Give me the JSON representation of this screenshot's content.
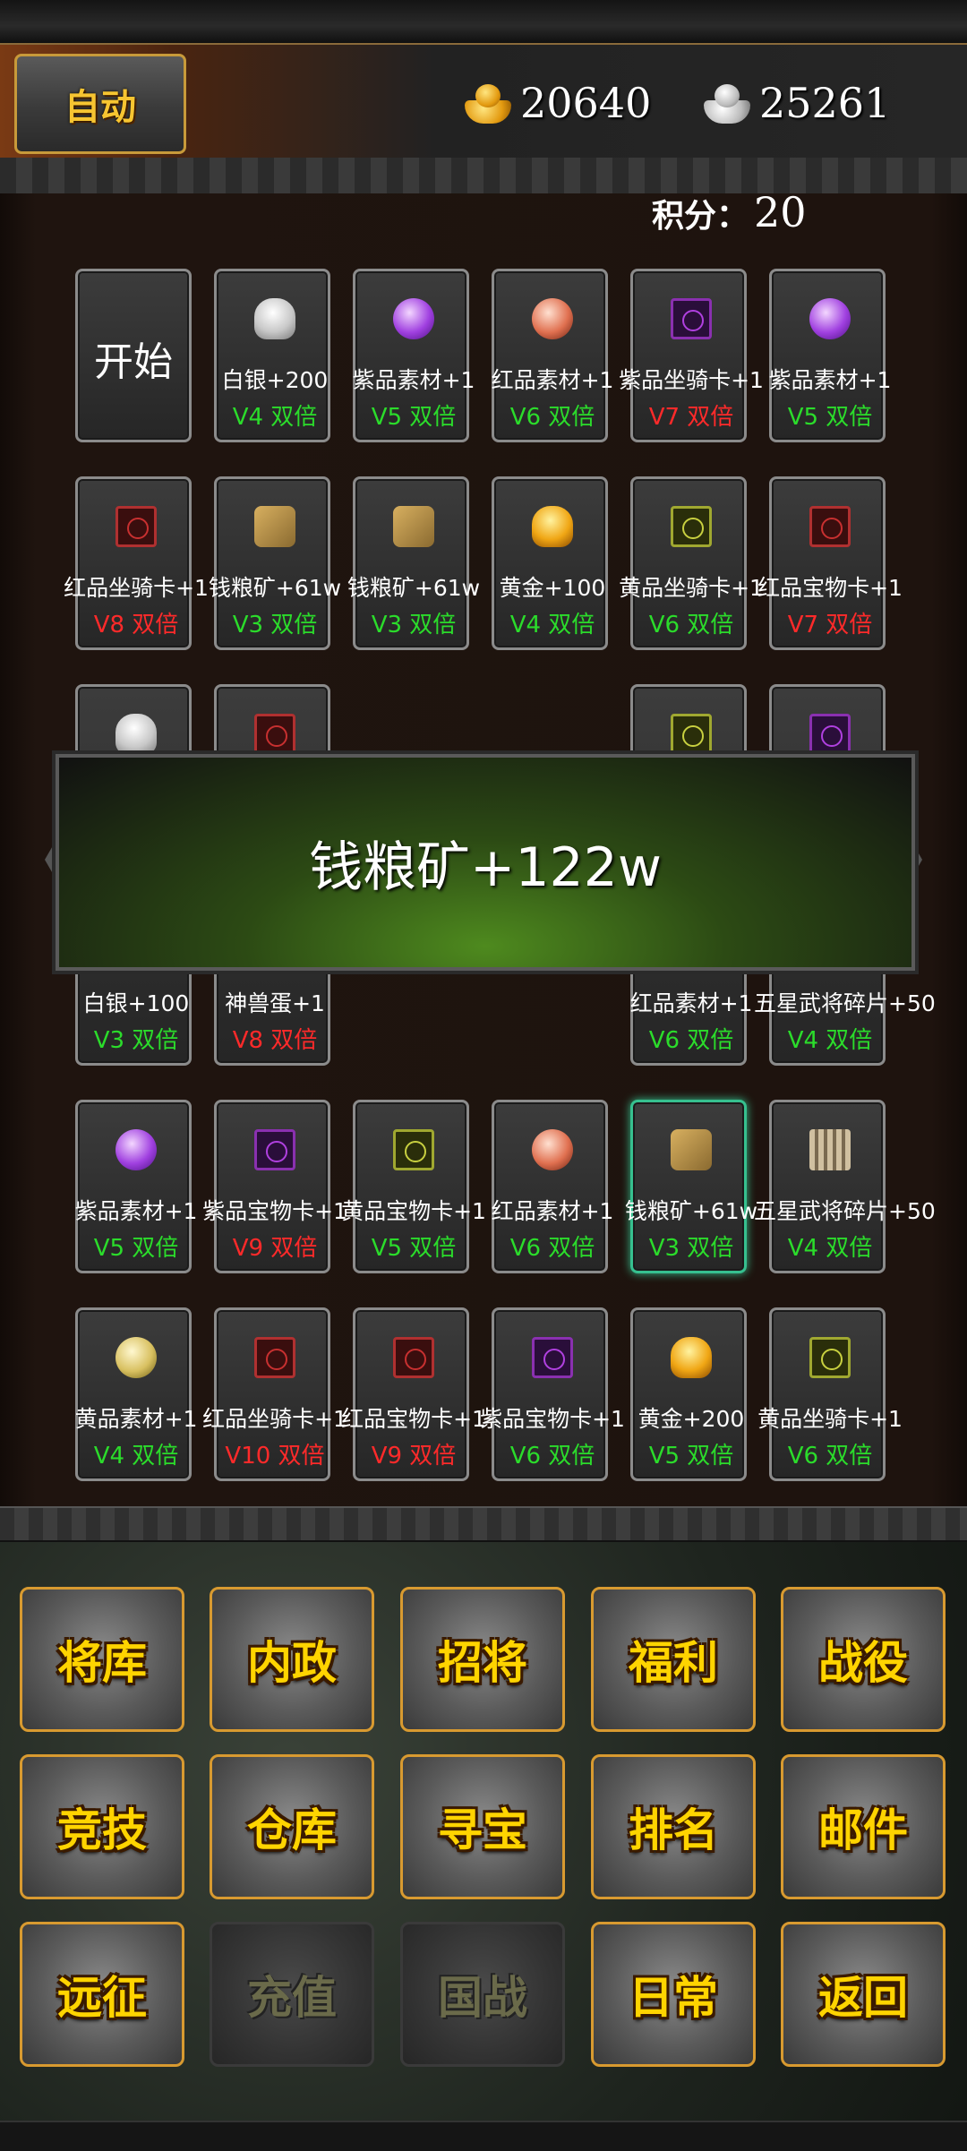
{
  "header": {
    "auto_label": "自动",
    "gold_amount": "20640",
    "silver_amount": "25261"
  },
  "score": {
    "label": "积分：",
    "value": "20"
  },
  "start_label": "开始",
  "cells": [
    {
      "name": "白银+200",
      "vip": "V4 双倍",
      "color": "green",
      "icon": "silver-ingot-icon"
    },
    {
      "name": "紫品素材+1",
      "vip": "V5 双倍",
      "color": "green",
      "icon": "purple-gem-icon"
    },
    {
      "name": "红品素材+1",
      "vip": "V6 双倍",
      "color": "green",
      "icon": "red-gem-icon"
    },
    {
      "name": "紫品坐骑卡+1",
      "vip": "V7 双倍",
      "color": "red",
      "icon": "purple-mount-card-icon"
    },
    {
      "name": "紫品素材+1",
      "vip": "V5 双倍",
      "color": "green",
      "icon": "purple-gem-icon"
    },
    {
      "name": "红品坐骑卡+1",
      "vip": "V8 双倍",
      "color": "red",
      "icon": "red-mount-card-icon"
    },
    {
      "name": "钱粮矿+61w",
      "vip": "V3 双倍",
      "color": "green",
      "icon": "grain-icon"
    },
    {
      "name": "钱粮矿+61w",
      "vip": "V3 双倍",
      "color": "green",
      "icon": "grain-icon"
    },
    {
      "name": "黄金+100",
      "vip": "V4 双倍",
      "color": "green",
      "icon": "gold-ingot-icon"
    },
    {
      "name": "黄品坐骑卡+1",
      "vip": "V6 双倍",
      "color": "green",
      "icon": "yellow-mount-card-icon"
    },
    {
      "name": "红品宝物卡+1",
      "vip": "V7 双倍",
      "color": "red",
      "icon": "red-treasure-card-icon"
    },
    {
      "name": "白银+100",
      "vip": "V3 双倍",
      "color": "green",
      "icon": "silver-ingot-icon"
    },
    {
      "name": "神兽蛋+1",
      "vip": "V8 双倍",
      "color": "red",
      "icon": "red-card-icon"
    },
    {
      "name": "红品素材+1",
      "vip": "V6 双倍",
      "color": "green",
      "icon": "yellow-card-icon"
    },
    {
      "name": "五星武将碎片+50",
      "vip": "V4 双倍",
      "color": "green",
      "icon": "purple-card-icon"
    },
    {
      "name": "紫品素材+1",
      "vip": "V5 双倍",
      "color": "green",
      "icon": "purple-gem-icon"
    },
    {
      "name": "紫品宝物卡+1",
      "vip": "V9 双倍",
      "color": "red",
      "icon": "purple-treasure-card-icon"
    },
    {
      "name": "黄品宝物卡+1",
      "vip": "V5 双倍",
      "color": "green",
      "icon": "yellow-treasure-card-icon"
    },
    {
      "name": "红品素材+1",
      "vip": "V6 双倍",
      "color": "green",
      "icon": "red-gem-icon"
    },
    {
      "name": "钱粮矿+61w",
      "vip": "V3 双倍",
      "color": "green",
      "icon": "grain-icon",
      "selected": true
    },
    {
      "name": "五星武将碎片+50",
      "vip": "V4 双倍",
      "color": "green",
      "icon": "general-fragment-icon"
    },
    {
      "name": "黄品素材+1",
      "vip": "V4 双倍",
      "color": "green",
      "icon": "yellow-gem-icon"
    },
    {
      "name": "红品坐骑卡+1",
      "vip": "V10 双倍",
      "color": "red",
      "icon": "red-mount-card-icon"
    },
    {
      "name": "红品宝物卡+1",
      "vip": "V9 双倍",
      "color": "red",
      "icon": "red-treasure-card-icon"
    },
    {
      "name": "紫品宝物卡+1",
      "vip": "V6 双倍",
      "color": "green",
      "icon": "purple-treasure-card-icon"
    },
    {
      "name": "黄金+200",
      "vip": "V5 双倍",
      "color": "green",
      "icon": "gold-ingot-icon"
    },
    {
      "name": "黄品坐骑卡+1",
      "vip": "V6 双倍",
      "color": "green",
      "icon": "yellow-mount-card-icon"
    }
  ],
  "banner": {
    "text": "钱粮矿+122w"
  },
  "menu": [
    {
      "label": "将库",
      "enabled": true
    },
    {
      "label": "内政",
      "enabled": true
    },
    {
      "label": "招将",
      "enabled": true
    },
    {
      "label": "福利",
      "enabled": true
    },
    {
      "label": "战役",
      "enabled": true
    },
    {
      "label": "竞技",
      "enabled": true
    },
    {
      "label": "仓库",
      "enabled": true
    },
    {
      "label": "寻宝",
      "enabled": true
    },
    {
      "label": "排名",
      "enabled": true
    },
    {
      "label": "邮件",
      "enabled": true
    },
    {
      "label": "远征",
      "enabled": true
    },
    {
      "label": "充值",
      "enabled": false
    },
    {
      "label": "国战",
      "enabled": false
    },
    {
      "label": "日常",
      "enabled": true
    },
    {
      "label": "返回",
      "enabled": true
    }
  ],
  "colors": {
    "accent_gold": "#f7c531",
    "vip_green": "#2bdc2b",
    "vip_red": "#ff2a2a",
    "selected_border": "#36c08f"
  }
}
